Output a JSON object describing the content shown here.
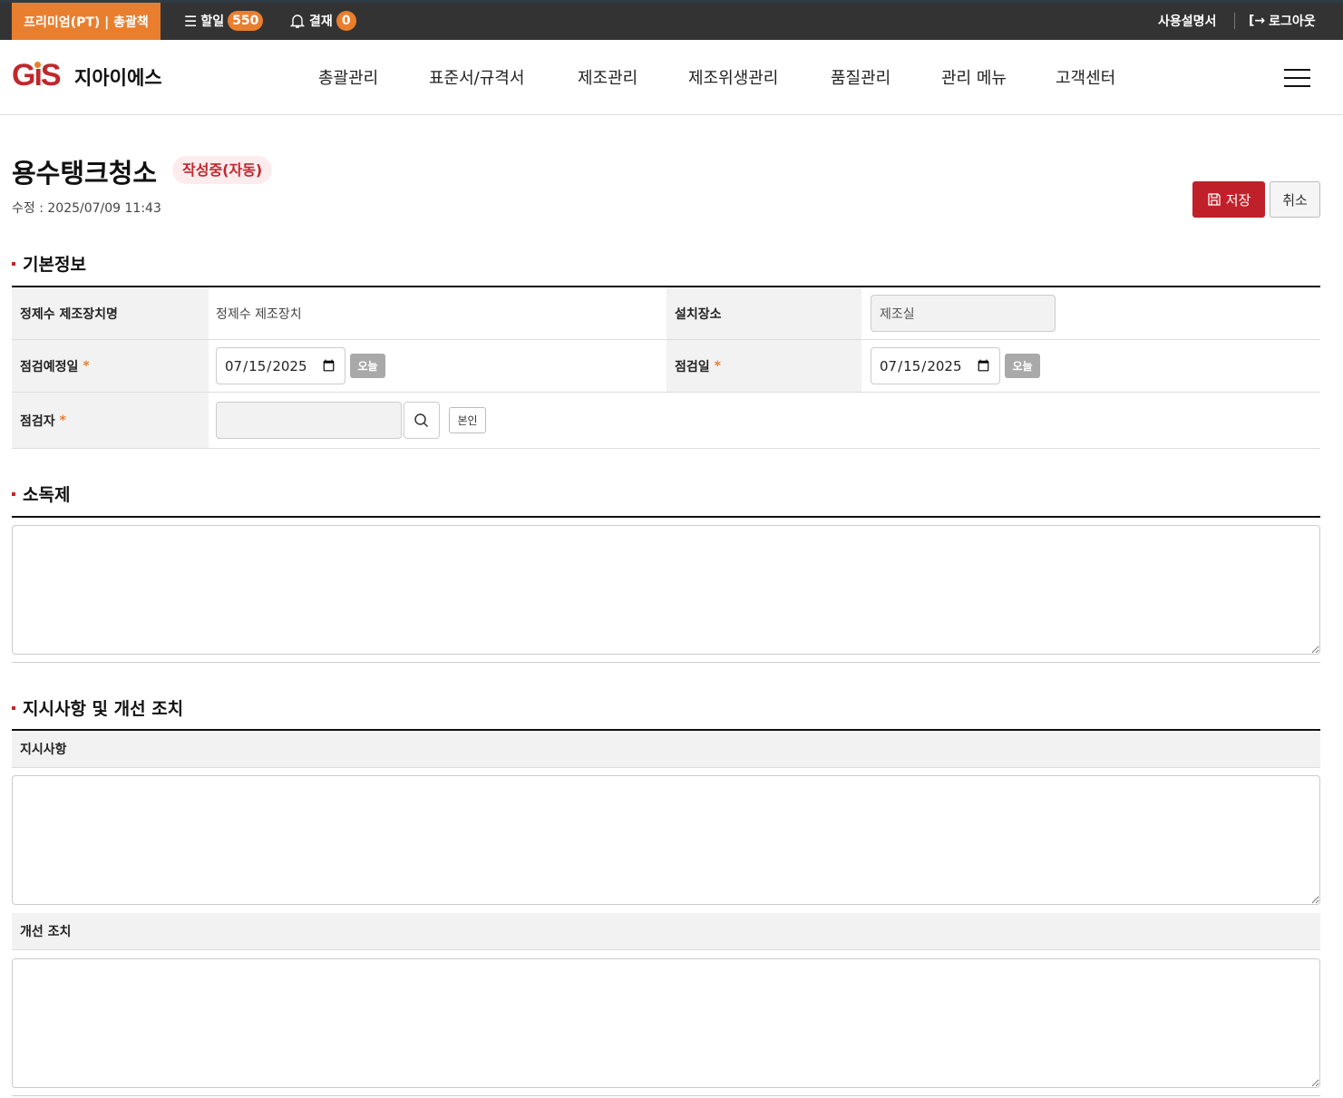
{
  "topbar": {
    "plan": "프리미엄(PT) | 총괄책",
    "todo_label": "할일",
    "todo_count": "550",
    "approval_label": "결재",
    "approval_count": "0",
    "manual": "사용설명서",
    "logout": "로그아웃"
  },
  "header": {
    "logo": "GiS",
    "company": "지아이에스",
    "nav": [
      "총괄관리",
      "표준서/규격서",
      "제조관리",
      "제조위생관리",
      "품질관리",
      "관리 메뉴",
      "고객센터"
    ]
  },
  "page": {
    "title": "용수탱크청소",
    "status": "작성중(자동)",
    "modified": "수정 : 2025/07/09 11:43",
    "save": "저장",
    "cancel": "취소"
  },
  "basic": {
    "section": "기본정보",
    "device_label": "정제수 제조장치명",
    "device_value": "정제수 제조장치",
    "location_label": "설치장소",
    "location_value": "제조실",
    "planned_label": "점검예정일",
    "planned_value": "2025-07-15",
    "date_label": "점검일",
    "date_value": "2025-07-15",
    "today": "오늘",
    "required": "*",
    "inspector_label": "점검자",
    "inspector_value": "",
    "self": "본인"
  },
  "disinfectant": {
    "section": "소독제",
    "value": ""
  },
  "instructions": {
    "section": "지시사항 및 개선 조치",
    "instr_label": "지시사항",
    "instr_value": "",
    "improve_label": "개선 조치",
    "improve_value": ""
  },
  "colors": {
    "accent": "#e97f2e",
    "brand": "#c0282d",
    "topbar": "#333333"
  }
}
